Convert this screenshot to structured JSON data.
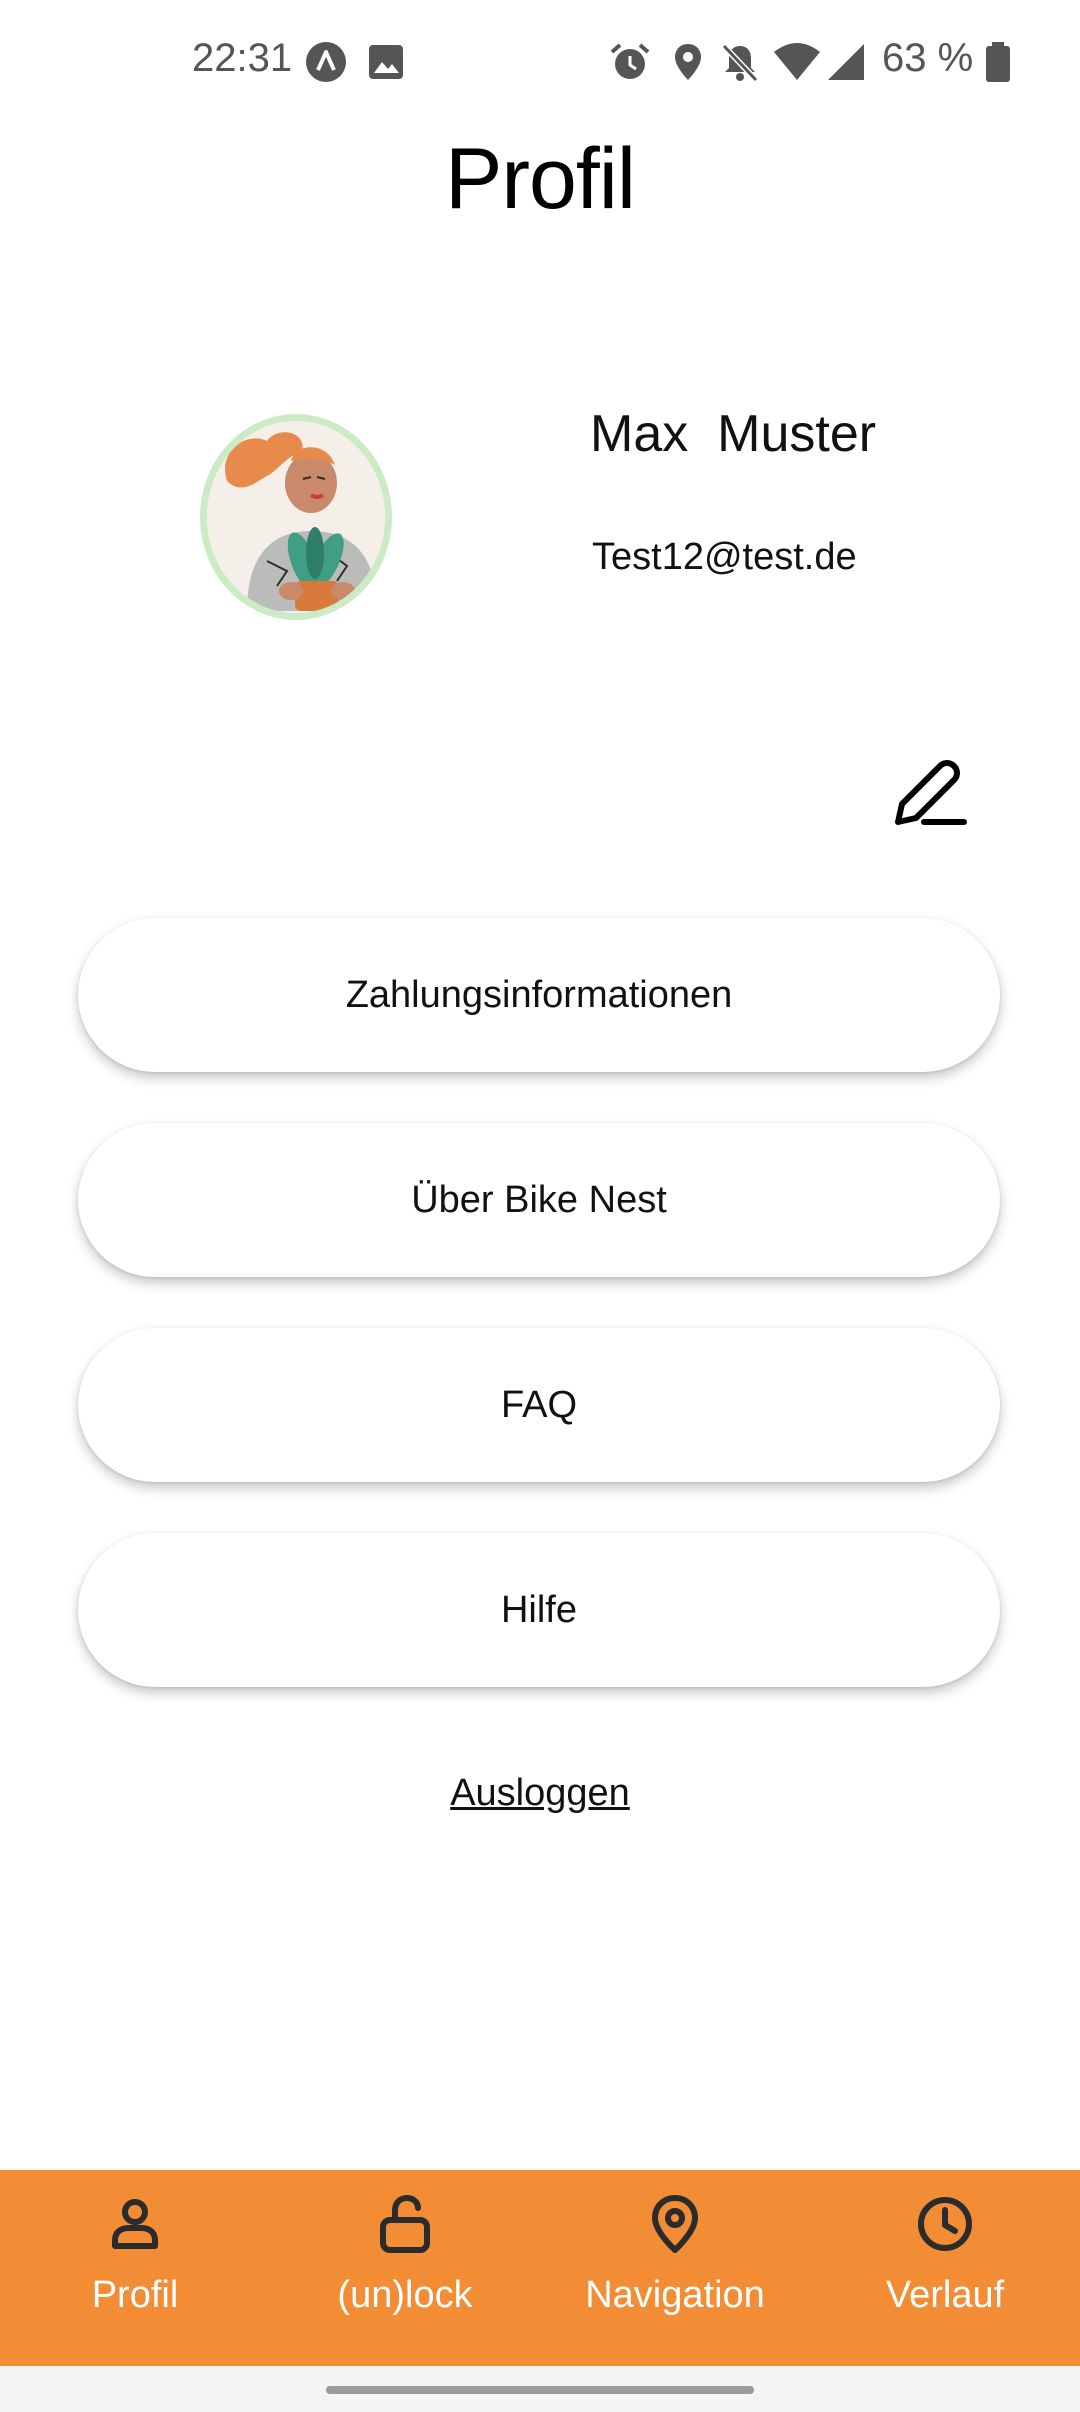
{
  "status_bar": {
    "time": "22:31",
    "battery_text": "63 %",
    "icons": [
      "app-notification-icon",
      "image-notification-icon",
      "alarm-icon",
      "location-icon",
      "mute-icon",
      "wifi-icon",
      "cell-signal-icon",
      "battery-icon"
    ]
  },
  "header": {
    "title": "Profil"
  },
  "profile": {
    "first_name": "Max",
    "last_name": "Muster",
    "email": "Test12@test.de"
  },
  "menu": {
    "items": [
      {
        "label": "Zahlungsinformationen"
      },
      {
        "label": "Über Bike Nest"
      },
      {
        "label": "FAQ"
      },
      {
        "label": "Hilfe"
      }
    ],
    "logout_label": "Ausloggen"
  },
  "bottom_nav": {
    "items": [
      {
        "label": "Profil",
        "icon": "user-icon"
      },
      {
        "label": "(un)lock",
        "icon": "unlock-icon"
      },
      {
        "label": "Navigation",
        "icon": "map-pin-icon"
      },
      {
        "label": "Verlauf",
        "icon": "clock-icon"
      }
    ]
  },
  "colors": {
    "accent": "#f28d35",
    "avatar_ring": "#ccebc5",
    "text": "#111111"
  }
}
